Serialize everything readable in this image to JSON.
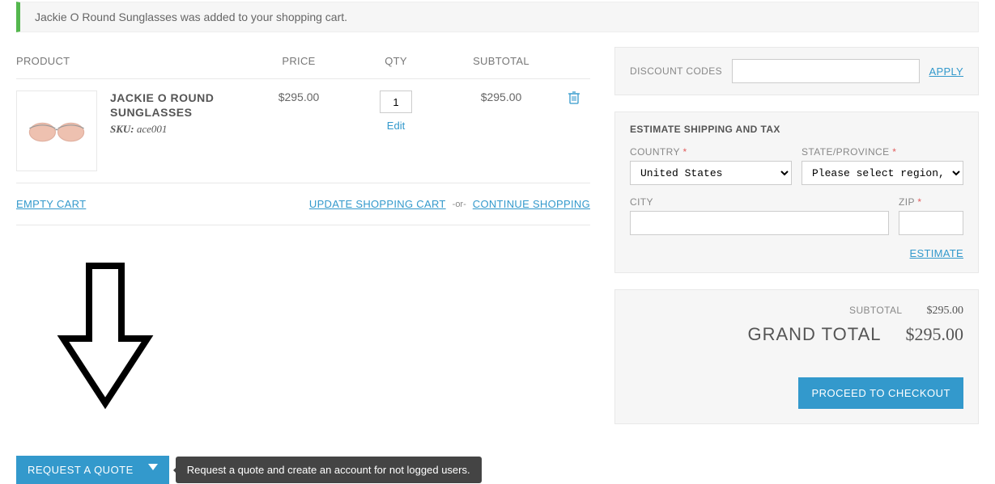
{
  "banner": {
    "message": "Jackie O Round Sunglasses was added to your shopping cart."
  },
  "headers": {
    "product": "PRODUCT",
    "price": "PRICE",
    "qty": "QTY",
    "subtotal": "SUBTOTAL"
  },
  "item": {
    "name": "JACKIE O ROUND SUNGLASSES",
    "sku_label": "SKU:",
    "sku": "ace001",
    "price": "$295.00",
    "qty": "1",
    "edit": "Edit",
    "subtotal": "$295.00"
  },
  "actions": {
    "empty": "EMPTY CART",
    "update": "UPDATE SHOPPING CART",
    "or": "-or-",
    "continue": "CONTINUE SHOPPING"
  },
  "quote": {
    "button": "REQUEST A QUOTE",
    "tooltip": "Request a quote and create an account for not logged users."
  },
  "discount": {
    "label": "DISCOUNT CODES",
    "apply": "APPLY"
  },
  "estimate": {
    "title": "ESTIMATE SHIPPING AND TAX",
    "country_label": "COUNTRY",
    "country_value": "United States",
    "state_label": "STATE/PROVINCE",
    "state_placeholder": "Please select region, state or province",
    "city_label": "CITY",
    "zip_label": "ZIP",
    "estimate": "ESTIMATE"
  },
  "totals": {
    "subtotal_label": "SUBTOTAL",
    "subtotal_value": "$295.00",
    "grand_label": "GRAND TOTAL",
    "grand_value": "$295.00",
    "checkout": "PROCEED TO CHECKOUT"
  }
}
